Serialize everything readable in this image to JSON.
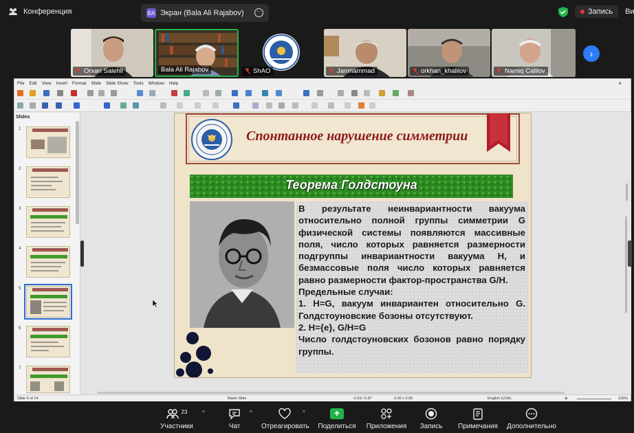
{
  "topbar": {
    "conference_label": "Конференция",
    "screen_tab_avatar": "BA",
    "screen_tab_label": "Экран (Bala Ali Rajabov)",
    "record_label": "Запись",
    "view_label": "Вид"
  },
  "participants": [
    {
      "name": "Orxan Salehli",
      "muted": true
    },
    {
      "name": "Bala Ali Rajabov",
      "muted": false,
      "active_speaker": true
    },
    {
      "name": "ShAO",
      "muted": true
    },
    {
      "name": "Janmammad",
      "muted": true
    },
    {
      "name": "orkhan_khalilov",
      "muted": true
    },
    {
      "name": "Namiq Calilov",
      "muted": true
    }
  ],
  "impress": {
    "menu": [
      "File",
      "Edit",
      "View",
      "Insert",
      "Format",
      "Slide",
      "Slide Show",
      "Tools",
      "Window",
      "Help"
    ],
    "slides_pane_title": "Slides",
    "thumb_numbers": [
      "1",
      "2",
      "3",
      "4",
      "5",
      "6",
      "7"
    ],
    "status": {
      "slide_info": "Slide 5 of 14",
      "layout": "Blank Slide",
      "coords": "-0.59 / 5.87",
      "size": "0.00 x 0.00",
      "language": "English (USA)",
      "zoom": "105%"
    }
  },
  "slide": {
    "title": "Спонтанное нарушение симметрии",
    "subtitle": "Теорема Голдстоуна",
    "paragraphs": [
      "В результате неинвариантности вакуума относительно полной группы симметрии G физической системы появляются массивные поля, число которых равняется размерности подгруппы инвариантности вакуума H, и безмассовые поля число которых равняется равно размерности фактор-пространства G/H.",
      "Предельные случаи:",
      "1. H=G, вакуум инвариантен относительно G. Голдстоуновские бозоны отсутствуют.",
      "2. H={e}, G/H=G",
      "Число голдстоуновских бозонов равно порядку группы."
    ]
  },
  "bottombar": {
    "participants_label": "Участники",
    "participants_count": "23",
    "chat_label": "Чат",
    "react_label": "Отреагировать",
    "share_label": "Поделиться",
    "apps_label": "Приложения",
    "record_label": "Запись",
    "notes_label": "Примечания",
    "more_label": "Дополнительно"
  },
  "colors": {
    "accent_green": "#24b24b",
    "record_red": "#e53935",
    "title_red": "#8b1a1a",
    "next_blue": "#2d7cf6"
  }
}
